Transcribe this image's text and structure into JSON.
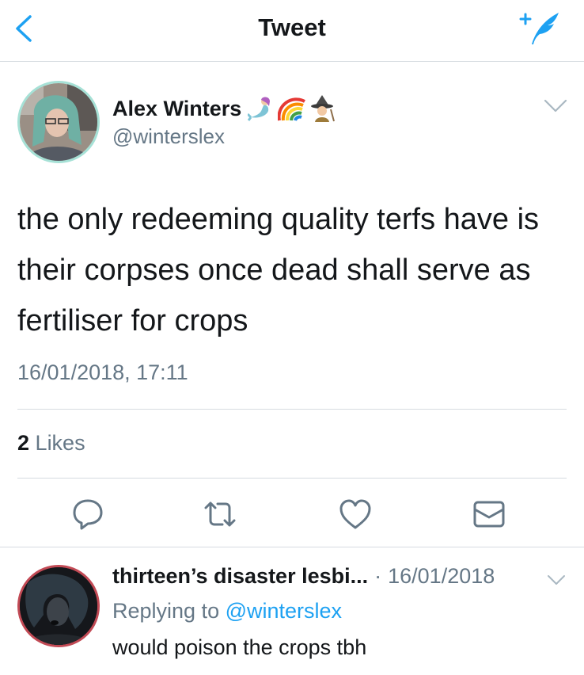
{
  "navbar": {
    "title": "Tweet",
    "back_icon": "chevron-left-icon",
    "compose_icon": "compose-tweet-icon"
  },
  "tweet": {
    "author_name": "Alex Winters",
    "author_emojis": [
      "mermaid-emoji",
      "rainbow-emoji",
      "witch-emoji"
    ],
    "author_handle": "@winterslex",
    "text": "the only redeeming quality terfs have is their corpses once dead shall serve as fertiliser for crops",
    "timestamp": "16/01/2018, 17:11",
    "likes_count": "2",
    "likes_label": "Likes"
  },
  "actions": [
    "reply-icon",
    "retweet-icon",
    "like-icon",
    "direct-message-icon"
  ],
  "reply": {
    "author_name": "thirteen’s disaster lesbi...",
    "separator": "·",
    "date": "16/01/2018",
    "replying_prefix": "Replying to",
    "replying_handle": "@winterslex",
    "text": "would poison the crops tbh"
  },
  "colors": {
    "accent": "#1da1f2",
    "secondary_text": "#657786",
    "divider": "#d6dbe0"
  }
}
